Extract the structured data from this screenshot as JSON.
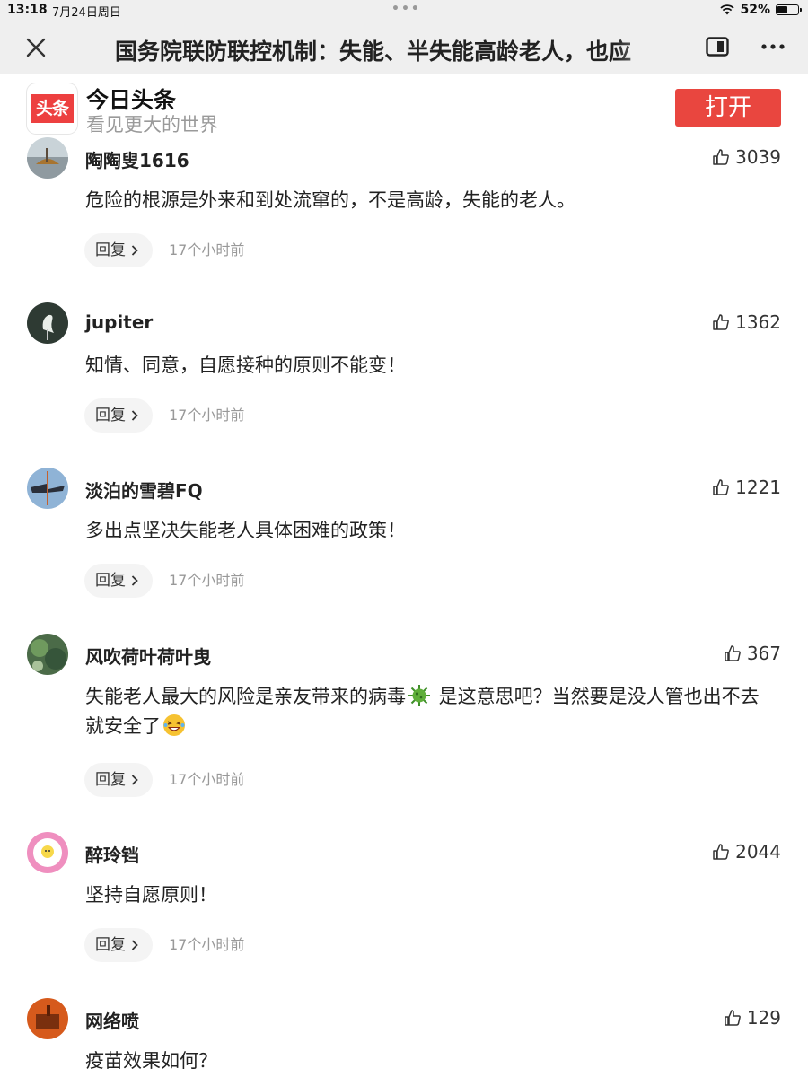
{
  "status_bar": {
    "time": "13:18",
    "date": "7月24日周日",
    "dots": "•••",
    "battery_text": "52%",
    "battery_level": 0.52
  },
  "nav": {
    "title": "国务院联防联控机制：失能、半失能高龄老人，也应",
    "close_icon": "close-icon",
    "reader_icon": "reader-mode-icon",
    "more_icon": "more-dots-icon"
  },
  "banner": {
    "logo_text": "头条",
    "app_name": "今日头条",
    "slogan": "看见更大的世界",
    "open_label": "打开"
  },
  "colors": {
    "brand_red": "#e9463f",
    "nav_bg": "#efefef",
    "muted_text": "#999999"
  },
  "comments": [
    {
      "username": "陶陶叟1616",
      "likes": "3039",
      "text": "危险的根源是外来和到处流窜的，不是高龄，失能的老人。",
      "reply_label": "回复",
      "time_ago": "17个小时前"
    },
    {
      "username": "jupiter",
      "likes": "1362",
      "text": "知情、同意，自愿接种的原则不能变！",
      "reply_label": "回复",
      "time_ago": "17个小时前"
    },
    {
      "username": "淡泊的雪碧FQ",
      "likes": "1221",
      "text": "多出点坚决失能老人具体困难的政策！",
      "reply_label": "回复",
      "time_ago": "17个小时前"
    },
    {
      "username": "风吹荷叶荷叶曳",
      "likes": "367",
      "text_part1": "失能老人最大的风险是亲友带来的病毒",
      "text_part2": " 是这意思吧？当然要是没人管也出不去就安全了",
      "emoji1": "virus-emoji-icon",
      "emoji2": "laughing-emoji-icon",
      "reply_label": "回复",
      "time_ago": "17个小时前"
    },
    {
      "username": "醉玲铛",
      "likes": "2044",
      "text": "坚持自愿原则！",
      "reply_label": "回复",
      "time_ago": "17个小时前"
    },
    {
      "username": "网络喷",
      "likes": "129",
      "text": "疫苗效果如何？"
    }
  ]
}
